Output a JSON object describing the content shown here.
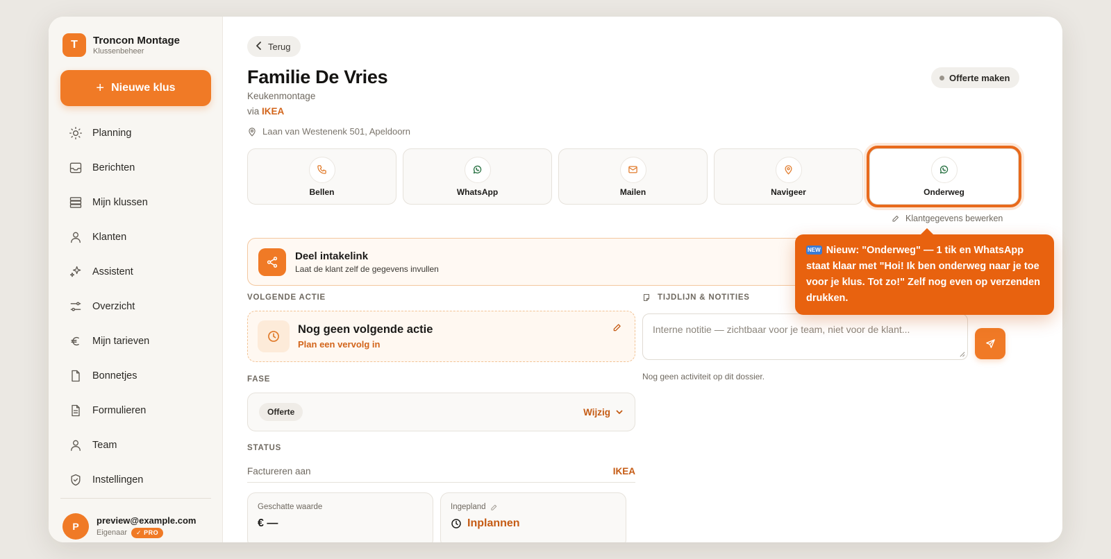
{
  "brand": {
    "logo_letter": "T",
    "name": "Troncon Montage",
    "subtitle": "Klussenbeheer"
  },
  "sidebar": {
    "new_button": "Nieuwe klus",
    "items": [
      {
        "label": "Planning",
        "icon": "sun-icon"
      },
      {
        "label": "Berichten",
        "icon": "inbox-icon"
      },
      {
        "label": "Mijn klussen",
        "icon": "stack-icon"
      },
      {
        "label": "Klanten",
        "icon": "person-icon"
      },
      {
        "label": "Assistent",
        "icon": "sparkle-icon"
      },
      {
        "label": "Overzicht",
        "icon": "sliders-icon"
      },
      {
        "label": "Mijn tarieven",
        "icon": "euro-icon"
      },
      {
        "label": "Bonnetjes",
        "icon": "file-icon"
      },
      {
        "label": "Formulieren",
        "icon": "form-icon"
      },
      {
        "label": "Team",
        "icon": "person-icon"
      },
      {
        "label": "Instellingen",
        "icon": "shield-icon"
      }
    ],
    "user": {
      "avatar_letter": "P",
      "email": "preview@example.com",
      "role": "Eigenaar",
      "badge": "✓ PRO"
    }
  },
  "main": {
    "back_label": "Terug",
    "title": "Familie De Vries",
    "subtitle": "Keukenmontage",
    "via_prefix": "via",
    "via_source": "IKEA",
    "address": "Laan van Westenenk 501, Apeldoorn",
    "offerte_button": "Offerte maken",
    "actions": [
      {
        "label": "Bellen",
        "icon": "phone-icon"
      },
      {
        "label": "WhatsApp",
        "icon": "whatsapp-icon"
      },
      {
        "label": "Mailen",
        "icon": "mail-icon"
      },
      {
        "label": "Navigeer",
        "icon": "map-pin-icon"
      },
      {
        "label": "Onderweg",
        "icon": "whatsapp-icon"
      }
    ],
    "edit_customer": "Klantgegevens bewerken",
    "intake": {
      "title": "Deel intakelink",
      "subtitle": "Laat de klant zelf de gegevens invullen"
    },
    "next_action_label": "VOLGENDE ACTIE",
    "next_action": {
      "title": "Nog geen volgende actie",
      "subtitle": "Plan een vervolg in"
    },
    "fase_label": "FASE",
    "fase": {
      "value": "Offerte",
      "change": "Wijzig"
    },
    "status_label": "STATUS",
    "status": {
      "label": "Factureren aan",
      "value": "IKEA"
    },
    "cards": [
      {
        "label": "Geschatte waarde",
        "value": "€  —"
      },
      {
        "label": "Ingepland",
        "value": "Inplannen"
      }
    ],
    "timeline_label": "TIJDLIJN & NOTITIES",
    "note_placeholder": "Interne notitie — zichtbaar voor je team, niet voor de klant...",
    "empty_activity": "Nog geen activiteit op dit dossier."
  },
  "tooltip": {
    "badge": "NEW",
    "text": "Nieuw: \"Onderweg\" — 1 tik en WhatsApp staat klaar met \"Hoi! Ik ben onderweg naar je toe voor je klus. Tot zo!\" Zelf nog even op verzenden drukken."
  },
  "colors": {
    "accent": "#f07a26",
    "accent_dark": "#c55b14",
    "tooltip": "#e8620f"
  }
}
